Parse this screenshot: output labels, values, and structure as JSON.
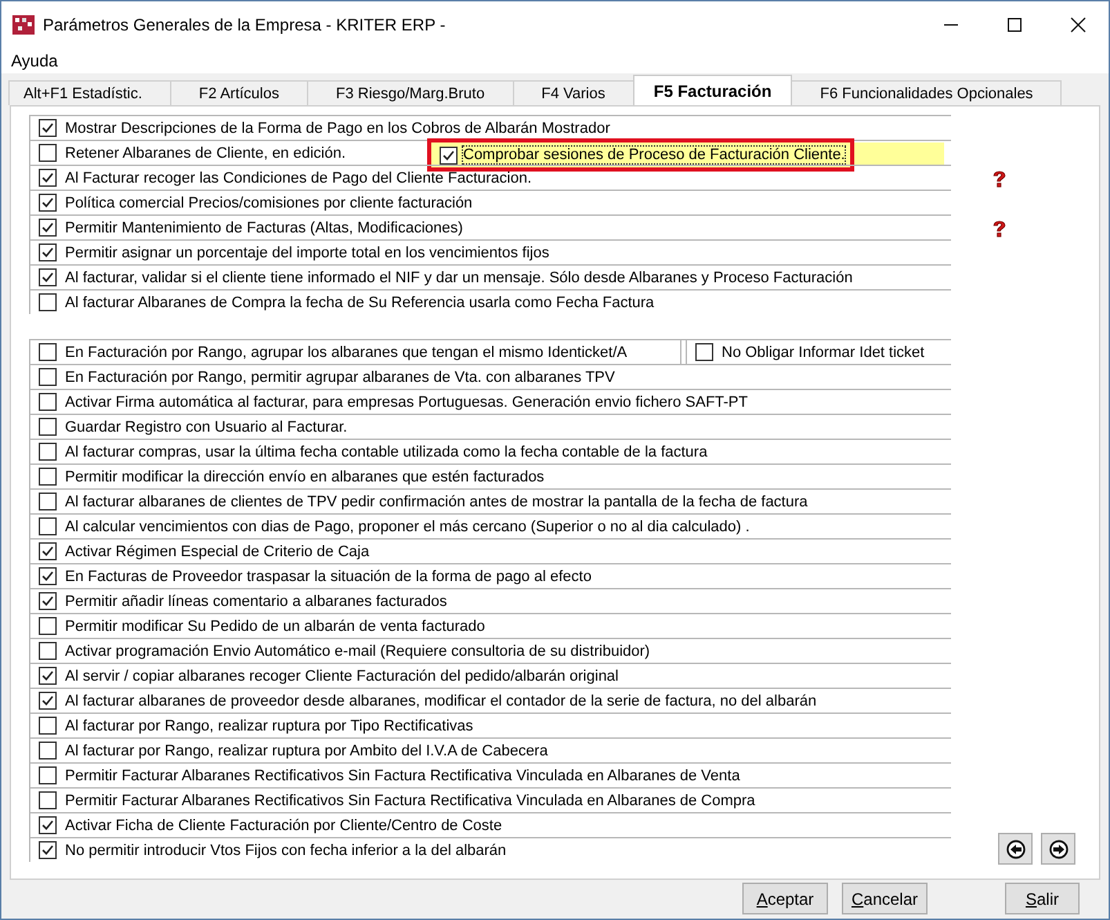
{
  "window": {
    "title": "Parámetros Generales de la Empresa - KRITER ERP -"
  },
  "menu": [
    "Ayuda"
  ],
  "tabs": [
    {
      "label": "Alt+F1 Estadístic.",
      "selected": false
    },
    {
      "label": "F2 Artículos",
      "selected": false
    },
    {
      "label": "F3 Riesgo/Marg.Bruto",
      "selected": false
    },
    {
      "label": "F4 Varios",
      "selected": false
    },
    {
      "label": "F5 Facturación",
      "selected": true
    },
    {
      "label": "F6 Funcionalidades Opcionales",
      "selected": false
    }
  ],
  "group_1": [
    {
      "label": "Mostrar Descripciones de la Forma de Pago en los Cobros de Albarán Mostrador",
      "checked": true,
      "help": false
    },
    {
      "label": "Retener Albaranes de Cliente, en edición.",
      "checked": false,
      "help": false
    },
    {
      "label": "Al Facturar recoger las Condiciones de Pago del Cliente Facturacion.",
      "checked": true,
      "help": true
    },
    {
      "label": "Política comercial Precios/comisiones por cliente facturación",
      "checked": true,
      "help": false
    },
    {
      "label": "Permitir Mantenimiento de Facturas (Altas, Modificaciones)",
      "checked": true,
      "help": true
    },
    {
      "label": "Permitir asignar un porcentaje del importe total en los vencimientos fijos",
      "checked": true,
      "help": false
    },
    {
      "label": "Al facturar, validar si el cliente tiene informado el NIF y dar un mensaje. Sólo desde Albaranes y Proceso Facturación",
      "checked": true,
      "help": false
    },
    {
      "label": "Al facturar Albaranes de Compra la fecha de Su Referencia usarla como Fecha Factura",
      "checked": false,
      "help": false
    }
  ],
  "highlighted_option": {
    "label": "Comprobar sesiones de Proceso de Facturación Cliente.",
    "checked": true
  },
  "group_2": [
    {
      "kind": "split",
      "label": "En Facturación por Rango, agrupar los albaranes que tengan el mismo Identicket/A",
      "checked": false,
      "extra": {
        "label": "No Obligar Informar Idet ticket",
        "checked": false
      }
    },
    {
      "kind": "single",
      "label": "En Facturación por Rango, permitir agrupar albaranes de Vta. con albaranes TPV",
      "checked": false
    },
    {
      "kind": "single",
      "label": "Activar Firma automática al facturar, para empresas Portuguesas. Generación envio fichero SAFT-PT",
      "checked": false
    },
    {
      "kind": "single",
      "label": "Guardar Registro con Usuario al Facturar.",
      "checked": false
    },
    {
      "kind": "single",
      "label": "Al facturar compras, usar la última fecha contable utilizada como la fecha contable de la factura",
      "checked": false
    },
    {
      "kind": "single",
      "label": "Permitir modificar la dirección envío en albaranes que estén facturados",
      "checked": false
    },
    {
      "kind": "single",
      "label": "Al facturar albaranes de clientes de TPV pedir confirmación antes de mostrar la pantalla de la fecha de factura",
      "checked": false
    },
    {
      "kind": "single",
      "label": "Al calcular vencimientos con dias de Pago, proponer el más cercano (Superior o no al dia calculado) .",
      "checked": false
    },
    {
      "kind": "single",
      "label": "Activar Régimen Especial de Criterio de Caja",
      "checked": true
    },
    {
      "kind": "single",
      "label": "En Facturas de Proveedor traspasar la situación de la forma de pago al efecto",
      "checked": true
    },
    {
      "kind": "single",
      "label": "Permitir añadir líneas comentario a albaranes facturados",
      "checked": true
    },
    {
      "kind": "single",
      "label": "Permitir modificar Su Pedido de un albarán de venta facturado",
      "checked": false
    },
    {
      "kind": "single",
      "label": "Activar programación Envio Automático e-mail (Requiere consultoria de su distribuidor)",
      "checked": false
    },
    {
      "kind": "single",
      "label": "Al servir / copiar albaranes recoger Cliente Facturación del pedido/albarán original",
      "checked": true
    },
    {
      "kind": "single",
      "label": "Al facturar albaranes de proveedor desde albaranes, modificar el contador de la serie de factura, no del albarán",
      "checked": true
    },
    {
      "kind": "single",
      "label": "Al facturar por Rango, realizar ruptura por Tipo Rectificativas",
      "checked": false
    },
    {
      "kind": "single",
      "label": "Al facturar por Rango, realizar ruptura por Ambito del I.V.A de Cabecera",
      "checked": false
    },
    {
      "kind": "single",
      "label": "Permitir Facturar Albaranes Rectificativos Sin Factura Rectificativa Vinculada en Albaranes de Venta",
      "checked": false
    },
    {
      "kind": "single",
      "label": "Permitir Facturar Albaranes Rectificativos Sin Factura Rectificativa Vinculada en Albaranes de Compra",
      "checked": false
    },
    {
      "kind": "single",
      "label": "Activar Ficha de Cliente Facturación por Cliente/Centro de Coste",
      "checked": true
    },
    {
      "kind": "single",
      "label": "No permitir introducir Vtos Fijos con fecha inferior a la del albarán",
      "checked": true
    }
  ],
  "buttons": [
    "Aceptar",
    "Cancelar",
    "Salir"
  ]
}
